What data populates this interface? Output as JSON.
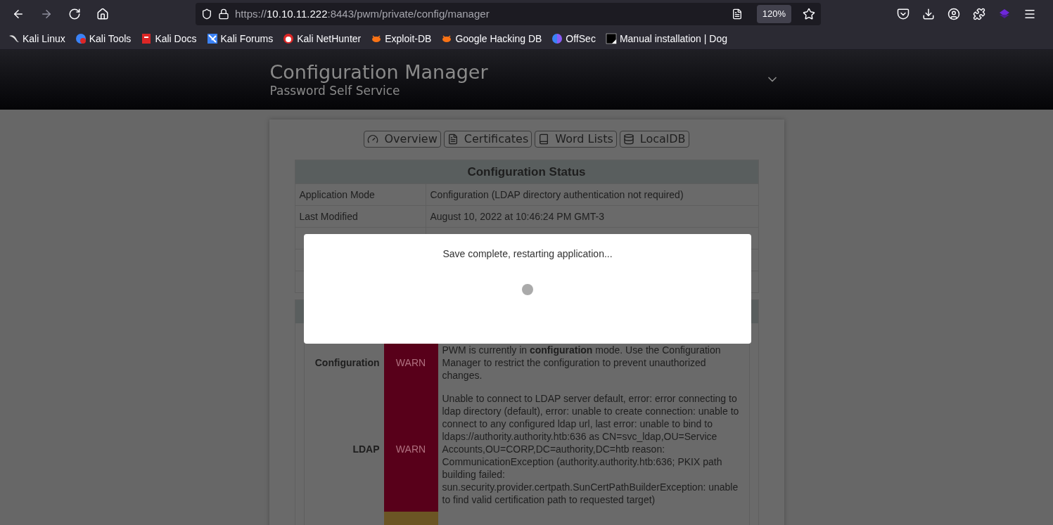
{
  "browser": {
    "url": {
      "scheme": "https://",
      "host": "10.10.11.222",
      "rest": ":8443/pwm/private/config/manager"
    },
    "zoom": "120%",
    "bookmarks": [
      {
        "label": "Kali Linux"
      },
      {
        "label": "Kali Tools"
      },
      {
        "label": "Kali Docs"
      },
      {
        "label": "Kali Forums"
      },
      {
        "label": "Kali NetHunter"
      },
      {
        "label": "Exploit-DB"
      },
      {
        "label": "Google Hacking DB"
      },
      {
        "label": "OffSec"
      },
      {
        "label": "Manual installation | Dog"
      }
    ]
  },
  "header": {
    "title": "Configuration Manager",
    "subtitle": "Password Self Service"
  },
  "nav_buttons": [
    {
      "label": "Overview"
    },
    {
      "label": "Certificates"
    },
    {
      "label": "Word Lists"
    },
    {
      "label": "LocalDB"
    }
  ],
  "config_status": {
    "title": "Configuration Status",
    "rows": [
      {
        "label": "Application Mode",
        "value": "Configuration (LDAP directory authentication not required)"
      },
      {
        "label": "Last Modified",
        "value": "August 10, 2022 at 10:46:24 PM GMT-3"
      }
    ]
  },
  "health": {
    "rows": [
      {
        "topic": "Configuration",
        "status": "WARN",
        "color": "#58001a",
        "message": "PWM is currently in **configuration** mode. Use the Configuration Manager to restrict the configuration to prevent unauthorized changes."
      },
      {
        "topic": "LDAP",
        "status": "WARN",
        "color": "#58001a",
        "message": "Unable to connect to LDAP server default, error: error connecting to ldap directory (default), error: unable to create connection: unable to connect to any configured ldap url, last error: unable to bind to ldaps://authority.authority.htb:636 as CN=svc_ldap,OU=Service Accounts,OU=CORP,DC=authority,DC=htb reason: CommunicationException (authority.authority.htb:636; PKIX path building failed: sun.security.provider.certpath.SunCertPathBuilderException: unable to find valid certification path to requested target)"
      },
      {
        "color": "#6b5524"
      }
    ]
  },
  "modal": {
    "message": "Save complete, restarting application..."
  }
}
